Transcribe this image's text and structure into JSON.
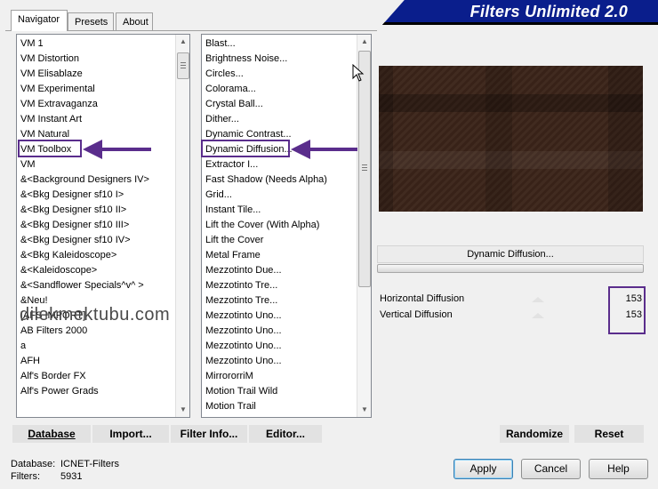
{
  "banner": {
    "title": "Filters Unlimited 2.0"
  },
  "tabs": [
    {
      "label": "Navigator"
    },
    {
      "label": "Presets"
    },
    {
      "label": "About"
    }
  ],
  "categories": [
    "VM 1",
    "VM Distortion",
    "VM Elisablaze",
    "VM Experimental",
    "VM Extravaganza",
    "VM Instant Art",
    "VM Natural",
    "VM Toolbox",
    "VM",
    "&<Background Designers IV>",
    "&<Bkg Designer sf10 I>",
    "&<Bkg Designer sf10 II>",
    "&<Bkg Designer sf10 III>",
    "&<Bkg Designer sf10 IV>",
    "&<Bkg Kaleidoscope>",
    "&<Kaleidoscope>",
    "&<Sandflower Specials^v^ >",
    "&Neu!",
    "[AFS IMPORT]",
    "AB Filters 2000",
    "a",
    "AFH",
    "Alf's Border FX",
    "Alf's Power Grads"
  ],
  "filters": [
    "Blast...",
    "Brightness Noise...",
    "Circles...",
    "Colorama...",
    "Crystal Ball...",
    "Dither...",
    "Dynamic Contrast...",
    "Dynamic Diffusion...",
    "Extractor I...",
    "Fast Shadow (Needs Alpha)",
    "Grid...",
    "Instant Tile...",
    "Lift the Cover (With Alpha)",
    "Lift the Cover",
    "Metal Frame",
    "Mezzotinto Due...",
    "Mezzotinto Tre...",
    "Mezzotinto Tre...",
    "Mezzotinto Uno...",
    "Mezzotinto Uno...",
    "Mezzotinto Uno...",
    "Mezzotinto Uno...",
    "MirrororriM",
    "Motion Trail Wild",
    "Motion Trail"
  ],
  "selected_category": "VM Toolbox",
  "selected_filter": "Dynamic Diffusion...",
  "watermark": "dilekmektubu.com",
  "filter_name_button": "Dynamic Diffusion...",
  "params": [
    {
      "label": "Horizontal Diffusion",
      "value": "153"
    },
    {
      "label": "Vertical Diffusion",
      "value": "153"
    }
  ],
  "bottom_buttons": {
    "database": "Database",
    "import": "Import...",
    "filter_info": "Filter Info...",
    "editor": "Editor...",
    "randomize": "Randomize",
    "reset": "Reset"
  },
  "status": {
    "database_label": "Database:",
    "database_value": "ICNET-Filters",
    "filters_label": "Filters:",
    "filters_value": "5931"
  },
  "dialog_buttons": {
    "apply": "Apply",
    "cancel": "Cancel",
    "help": "Help"
  },
  "colors": {
    "banner": "#0a1e8c",
    "highlight": "#5a2d8c",
    "preview": "#3b2419"
  }
}
